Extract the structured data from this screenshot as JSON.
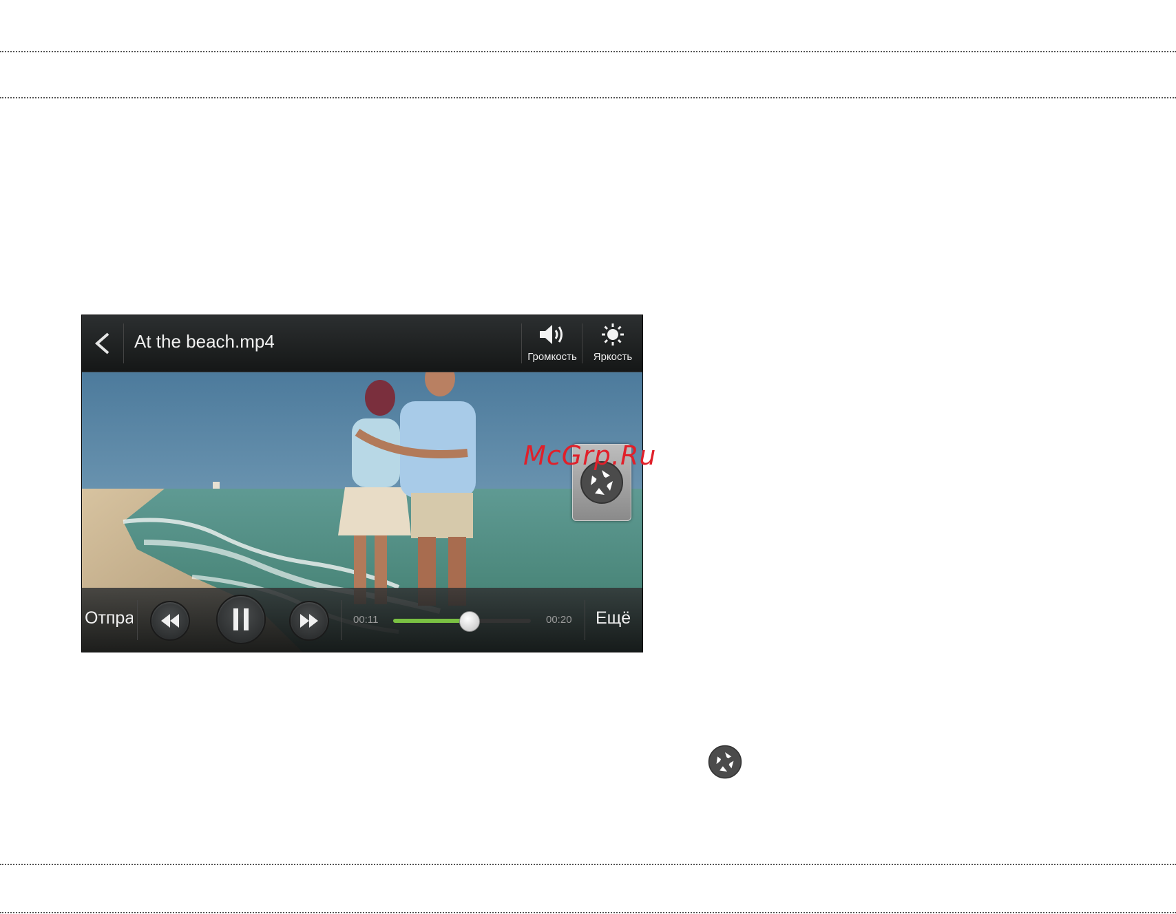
{
  "watermark": "McGrp.Ru",
  "player": {
    "title": "At the beach.mp4",
    "actions": {
      "volume": "Громкость",
      "brightness": "Яркость"
    },
    "controls": {
      "share_label": "Отправить",
      "more_label": "Ещё",
      "current_time": "00:11",
      "total_time": "00:20",
      "progress": 0.55
    }
  },
  "colors": {
    "progress_fill": "#7ac143",
    "watermark": "#e0202a"
  },
  "icons": [
    "back-arrow-icon",
    "speaker-icon",
    "brightness-icon",
    "aperture-icon",
    "rewind-icon",
    "pause-icon",
    "fast-forward-icon"
  ]
}
